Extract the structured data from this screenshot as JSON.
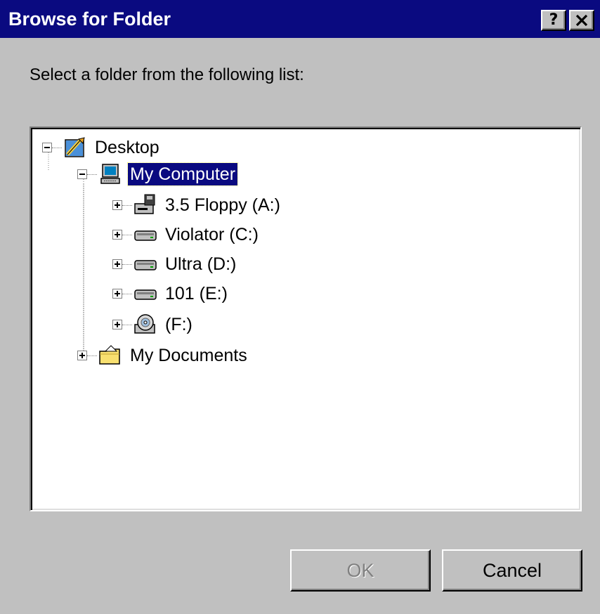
{
  "window": {
    "title": "Browse for Folder",
    "help_label": "?",
    "title_bar_color": "#0a0a80"
  },
  "prompt": "Select a folder from the following list:",
  "tree": {
    "items": [
      {
        "label": "Desktop",
        "icon": "desktop-icon",
        "expander": "minus",
        "level": 0,
        "selected": false
      },
      {
        "label": "My Computer",
        "icon": "computer-icon",
        "expander": "minus",
        "level": 1,
        "selected": true
      },
      {
        "label": "3.5 Floppy (A:)",
        "icon": "floppy-drive-icon",
        "expander": "plus",
        "level": 2,
        "selected": false
      },
      {
        "label": "Violator (C:)",
        "icon": "hard-drive-icon",
        "expander": "plus",
        "level": 2,
        "selected": false
      },
      {
        "label": "Ultra (D:)",
        "icon": "hard-drive-icon",
        "expander": "plus",
        "level": 2,
        "selected": false
      },
      {
        "label": "101 (E:)",
        "icon": "hard-drive-icon",
        "expander": "plus",
        "level": 2,
        "selected": false
      },
      {
        "label": "(F:)",
        "icon": "cd-drive-icon",
        "expander": "plus",
        "level": 2,
        "selected": false
      },
      {
        "label": "My Documents",
        "icon": "folder-icon",
        "expander": "plus",
        "level": 1,
        "selected": false
      }
    ]
  },
  "buttons": {
    "ok_label": "OK",
    "ok_enabled": false,
    "cancel_label": "Cancel"
  },
  "colors": {
    "selection": "#0a0a80",
    "dialog_face": "#c0c0c0"
  }
}
